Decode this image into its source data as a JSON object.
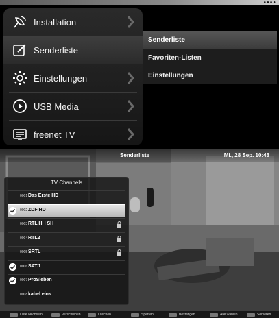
{
  "main_menu": {
    "items": [
      {
        "label": "Installation",
        "icon": "satellite-icon"
      },
      {
        "label": "Senderliste",
        "icon": "edit-icon"
      },
      {
        "label": "Einstellungen",
        "icon": "gear-icon"
      },
      {
        "label": "USB Media",
        "icon": "play-icon"
      },
      {
        "label": "freenet TV",
        "icon": "tv-guide-icon"
      }
    ]
  },
  "submenu": {
    "items": [
      {
        "label": "Senderliste"
      },
      {
        "label": "Favoriten-Listen"
      },
      {
        "label": "Einstellungen"
      }
    ]
  },
  "tv": {
    "header_title": "Senderliste",
    "clock": "Mi., 28 Sep.   10:48"
  },
  "channel_list": {
    "title": "TV Channels",
    "rows": [
      {
        "num": "0001",
        "name": "Das Erste HD",
        "checked": false,
        "locked": false,
        "selected": false
      },
      {
        "num": "0002",
        "name": "ZDF HD",
        "checked": true,
        "locked": false,
        "selected": true
      },
      {
        "num": "0003",
        "name": "RTL HH SH",
        "checked": false,
        "locked": true,
        "selected": false
      },
      {
        "num": "0004",
        "name": "RTL2",
        "checked": false,
        "locked": true,
        "selected": false
      },
      {
        "num": "0005",
        "name": "SRTL",
        "checked": false,
        "locked": true,
        "selected": false
      },
      {
        "num": "0006",
        "name": "SAT.1",
        "checked": true,
        "locked": false,
        "selected": false
      },
      {
        "num": "0007",
        "name": "ProSieben",
        "checked": true,
        "locked": false,
        "selected": false
      },
      {
        "num": "0008",
        "name": "kabel eins",
        "checked": false,
        "locked": false,
        "selected": false
      }
    ]
  },
  "legend": {
    "items": [
      {
        "label": "Liste wechseln"
      },
      {
        "label": "Verschieben"
      },
      {
        "label": "Löschen"
      },
      {
        "label": "Sperren"
      },
      {
        "label": "Bestätigen"
      },
      {
        "label": "Alle wählen"
      },
      {
        "label": "Sortieren"
      }
    ]
  },
  "colors": {
    "menu_bg": "#222222",
    "active_highlight": "#4a4a4a",
    "selected_row": "#d0d0d0"
  }
}
